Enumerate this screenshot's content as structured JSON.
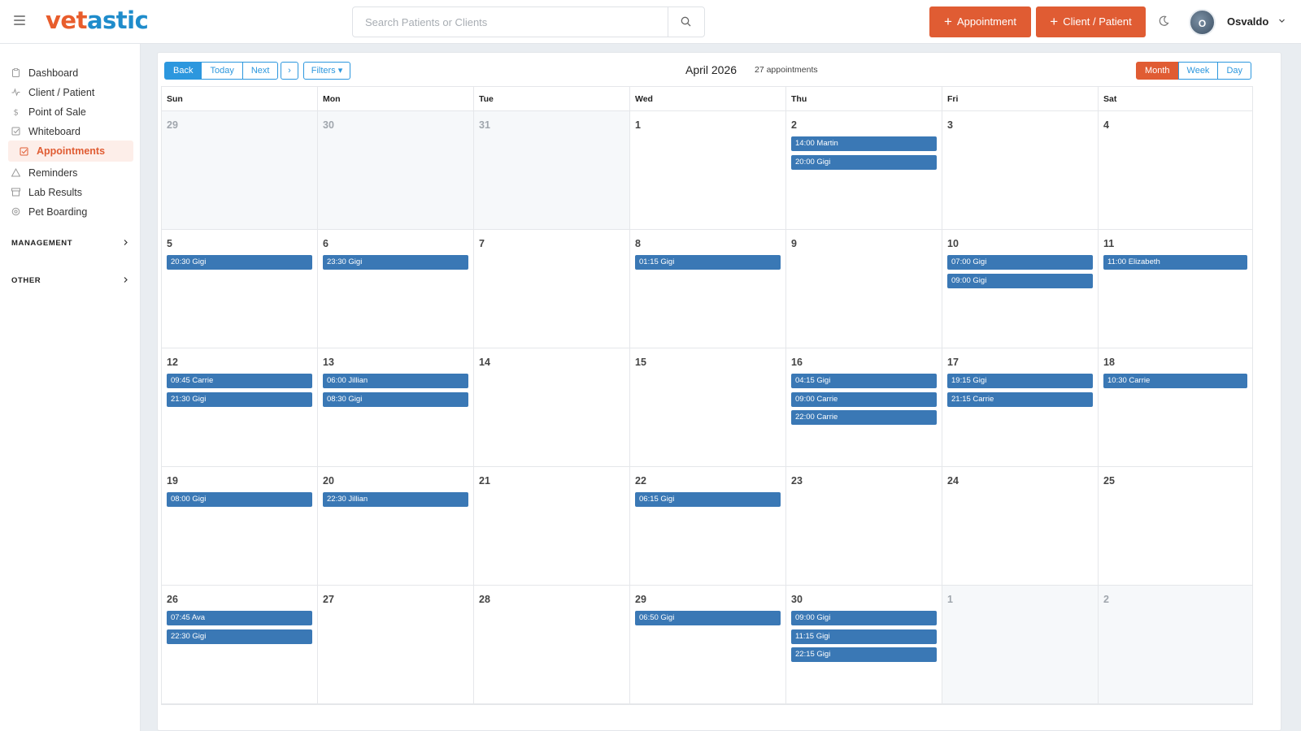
{
  "header": {
    "logo_part1": "vet",
    "logo_part2": "astic",
    "search_placeholder": "Search Patients or Clients",
    "appointment_btn": "Appointment",
    "client_patient_btn": "Client / Patient",
    "user_initial": "O",
    "user_name": "Osvaldo"
  },
  "sidebar": {
    "items": [
      {
        "label": "Dashboard",
        "icon": "clipboard-icon"
      },
      {
        "label": "Client / Patient",
        "icon": "pulse-icon"
      },
      {
        "label": "Point of Sale",
        "icon": "dollar-icon"
      },
      {
        "label": "Whiteboard",
        "icon": "checkbox-icon"
      },
      {
        "label": "Appointments",
        "icon": "calendar-check-icon",
        "active": true
      },
      {
        "label": "Reminders",
        "icon": "alert-icon"
      },
      {
        "label": "Lab Results",
        "icon": "archive-icon"
      },
      {
        "label": "Pet Boarding",
        "icon": "settings-icon"
      }
    ],
    "sections": [
      "MANAGEMENT",
      "OTHER"
    ]
  },
  "toolbar": {
    "back": "Back",
    "today": "Today",
    "next": "Next",
    "chevron": "›",
    "filters": "Filters ▾",
    "title": "April 2026",
    "count": "27 appointments",
    "views": [
      "Month",
      "Week",
      "Day"
    ],
    "active_view": "Month"
  },
  "calendar": {
    "weekdays": [
      "Sun",
      "Mon",
      "Tue",
      "Wed",
      "Thu",
      "Fri",
      "Sat"
    ],
    "weeks": [
      [
        {
          "day": "29",
          "off": true,
          "events": []
        },
        {
          "day": "30",
          "off": true,
          "events": []
        },
        {
          "day": "31",
          "off": true,
          "events": []
        },
        {
          "day": "1",
          "events": []
        },
        {
          "day": "2",
          "events": [
            "14:00 Martin",
            "20:00 Gigi"
          ]
        },
        {
          "day": "3",
          "events": []
        },
        {
          "day": "4",
          "events": []
        }
      ],
      [
        {
          "day": "5",
          "events": [
            "20:30 Gigi"
          ]
        },
        {
          "day": "6",
          "events": [
            "23:30 Gigi"
          ]
        },
        {
          "day": "7",
          "events": []
        },
        {
          "day": "8",
          "events": [
            "01:15 Gigi"
          ]
        },
        {
          "day": "9",
          "events": []
        },
        {
          "day": "10",
          "events": [
            "07:00 Gigi",
            "09:00 Gigi"
          ]
        },
        {
          "day": "11",
          "events": [
            "11:00 Elizabeth"
          ]
        }
      ],
      [
        {
          "day": "12",
          "events": [
            "09:45 Carrie",
            "21:30 Gigi"
          ]
        },
        {
          "day": "13",
          "events": [
            "06:00 Jillian",
            "08:30 Gigi"
          ]
        },
        {
          "day": "14",
          "events": []
        },
        {
          "day": "15",
          "events": []
        },
        {
          "day": "16",
          "events": [
            "04:15 Gigi",
            "09:00 Carrie",
            "22:00 Carrie"
          ]
        },
        {
          "day": "17",
          "events": [
            "19:15 Gigi",
            "21:15 Carrie"
          ]
        },
        {
          "day": "18",
          "events": [
            "10:30 Carrie"
          ]
        }
      ],
      [
        {
          "day": "19",
          "events": [
            "08:00 Gigi"
          ]
        },
        {
          "day": "20",
          "events": [
            "22:30 Jillian"
          ]
        },
        {
          "day": "21",
          "events": []
        },
        {
          "day": "22",
          "events": [
            "06:15 Gigi"
          ]
        },
        {
          "day": "23",
          "events": []
        },
        {
          "day": "24",
          "events": []
        },
        {
          "day": "25",
          "events": []
        }
      ],
      [
        {
          "day": "26",
          "events": [
            "07:45 Ava",
            "22:30 Gigi"
          ]
        },
        {
          "day": "27",
          "events": []
        },
        {
          "day": "28",
          "events": []
        },
        {
          "day": "29",
          "events": [
            "06:50 Gigi"
          ]
        },
        {
          "day": "30",
          "events": [
            "09:00 Gigi",
            "11:15 Gigi",
            "22:15 Gigi"
          ]
        },
        {
          "day": "1",
          "off": true,
          "events": []
        },
        {
          "day": "2",
          "off": true,
          "events": []
        }
      ]
    ]
  },
  "colors": {
    "brand_orange": "#e05c33",
    "brand_blue": "#2c97de",
    "event_blue": "#3a78b5"
  }
}
